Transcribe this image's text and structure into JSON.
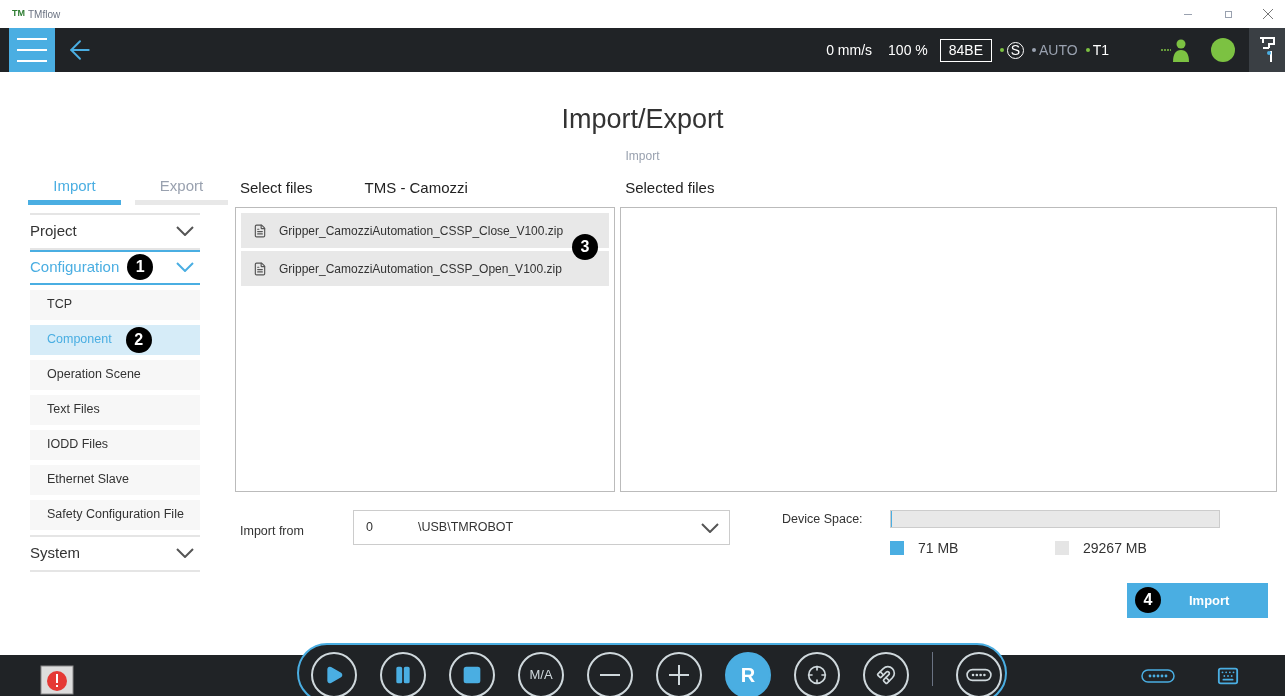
{
  "window": {
    "title": "TMflow",
    "logo": "TM"
  },
  "top_bar": {
    "speed": "0 mm/s",
    "percent": "100 %",
    "code": "84BE",
    "indicators": [
      {
        "label": "S",
        "kind": "circled",
        "on": true
      },
      {
        "label": "AUTO",
        "kind": "plain",
        "on": false
      },
      {
        "label": "T1",
        "kind": "plain",
        "on": true
      }
    ]
  },
  "page": {
    "title": "Import/Export",
    "subtitle": "Import"
  },
  "tabs": [
    {
      "label": "Import",
      "selected": true
    },
    {
      "label": "Export",
      "selected": false
    }
  ],
  "sidebar": [
    {
      "label": "Project",
      "expanded": false
    },
    {
      "label": "Configuration",
      "expanded": true,
      "callout": "1",
      "children": [
        {
          "label": "TCP",
          "selected": false
        },
        {
          "label": "Component",
          "selected": true,
          "callout": "2"
        },
        {
          "label": "Operation Scene",
          "selected": false
        },
        {
          "label": "Text Files",
          "selected": false
        },
        {
          "label": "IODD Files",
          "selected": false
        },
        {
          "label": "Ethernet Slave",
          "selected": false
        },
        {
          "label": "Safety Configuration File",
          "selected": false
        }
      ]
    },
    {
      "label": "System",
      "expanded": false
    }
  ],
  "select_files": {
    "heading": "Select files",
    "source": "TMS - Camozzi",
    "callout": "3",
    "files": [
      "Gripper_CamozziAutomation_CSSP_Close_V100.zip",
      "Gripper_CamozziAutomation_CSSP_Open_V100.zip"
    ]
  },
  "selected_files": {
    "heading": "Selected files"
  },
  "import_from": {
    "label": "Import from",
    "index": "0",
    "path": "\\USB\\TMROBOT"
  },
  "device_space": {
    "label": "Device Space:",
    "level": 0.002,
    "used": "71 MB",
    "free": "29267 MB"
  },
  "import_button": {
    "label": "Import",
    "callout": "4"
  },
  "controls": [
    {
      "kind": "play",
      "selected": false
    },
    {
      "kind": "pause",
      "selected": false
    },
    {
      "kind": "stop",
      "selected": false
    },
    {
      "kind": "text",
      "label": "M/A",
      "selected": false
    },
    {
      "kind": "minus",
      "selected": false
    },
    {
      "kind": "plus",
      "selected": false
    },
    {
      "kind": "text",
      "label": "R",
      "selected": true
    },
    {
      "kind": "target",
      "selected": false
    },
    {
      "kind": "gripper",
      "selected": false
    },
    {
      "kind": "keypad",
      "selected": false
    }
  ]
}
